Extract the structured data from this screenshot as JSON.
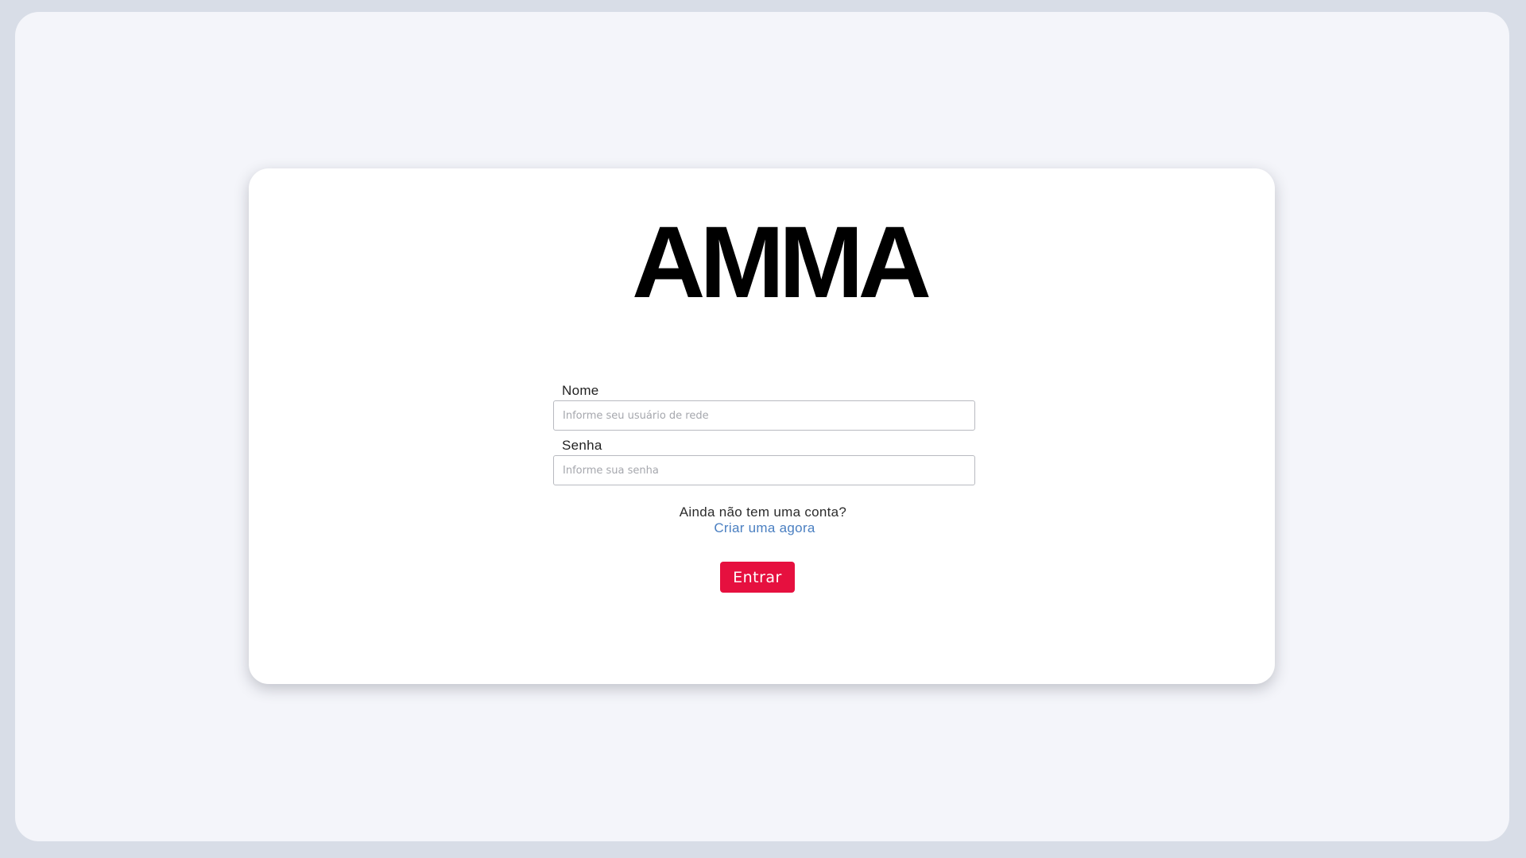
{
  "app": {
    "logo_text": "AMMA"
  },
  "login_form": {
    "username": {
      "label": "Nome",
      "placeholder": "Informe seu usuário de rede",
      "value": ""
    },
    "password": {
      "label": "Senha",
      "placeholder": "Informe sua senha",
      "value": ""
    },
    "signup_question": "Ainda não tem uma conta?",
    "signup_link": "Criar uma agora",
    "submit_label": "Entrar"
  },
  "colors": {
    "page_background": "#d8dde7",
    "panel_background": "#f4f5fa",
    "card_background": "#ffffff",
    "primary_button": "#e6103f",
    "link": "#4a7fc1"
  }
}
